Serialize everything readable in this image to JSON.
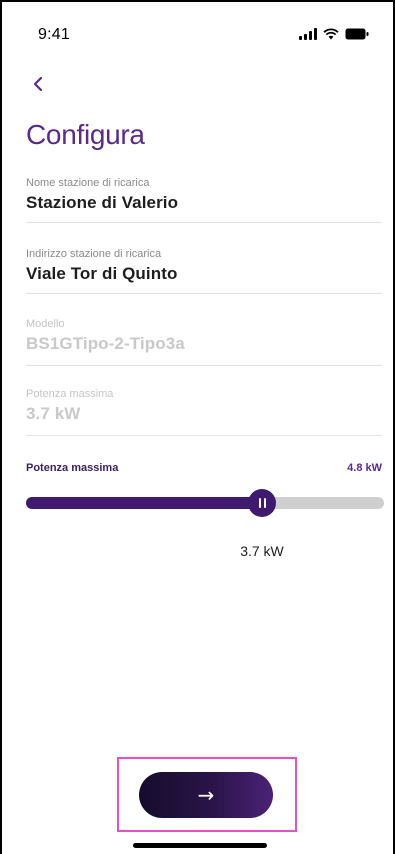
{
  "status_bar": {
    "time": "9:41",
    "icons": [
      "cellular-signal-icon",
      "wifi-icon",
      "battery-icon"
    ]
  },
  "header": {
    "back_icon": "chevron-left-icon",
    "title": "Configura"
  },
  "form": {
    "fields": [
      {
        "label": "Nome stazione di ricarica",
        "value": "Stazione di Valerio",
        "disabled": false
      },
      {
        "label": "Indirizzo stazione di ricarica",
        "value": "Viale Tor di Quinto",
        "disabled": false
      },
      {
        "label": "Modello",
        "value": "BS1GTipo-2-Tipo3a",
        "disabled": true
      },
      {
        "label": "Potenza massima",
        "value": "3.7 kW",
        "disabled": true
      }
    ]
  },
  "power_slider": {
    "label": "Potenza massima",
    "max_label": "4.8 kW",
    "current_label": "3.7 kW",
    "fill_fraction": 0.66
  },
  "footer": {
    "next_icon": "arrow-right-icon",
    "next_arrow": "→"
  },
  "colors": {
    "accent": "#5a2a8e",
    "slider_fill": "#3f1a6e",
    "highlight": "#e74fcf"
  }
}
